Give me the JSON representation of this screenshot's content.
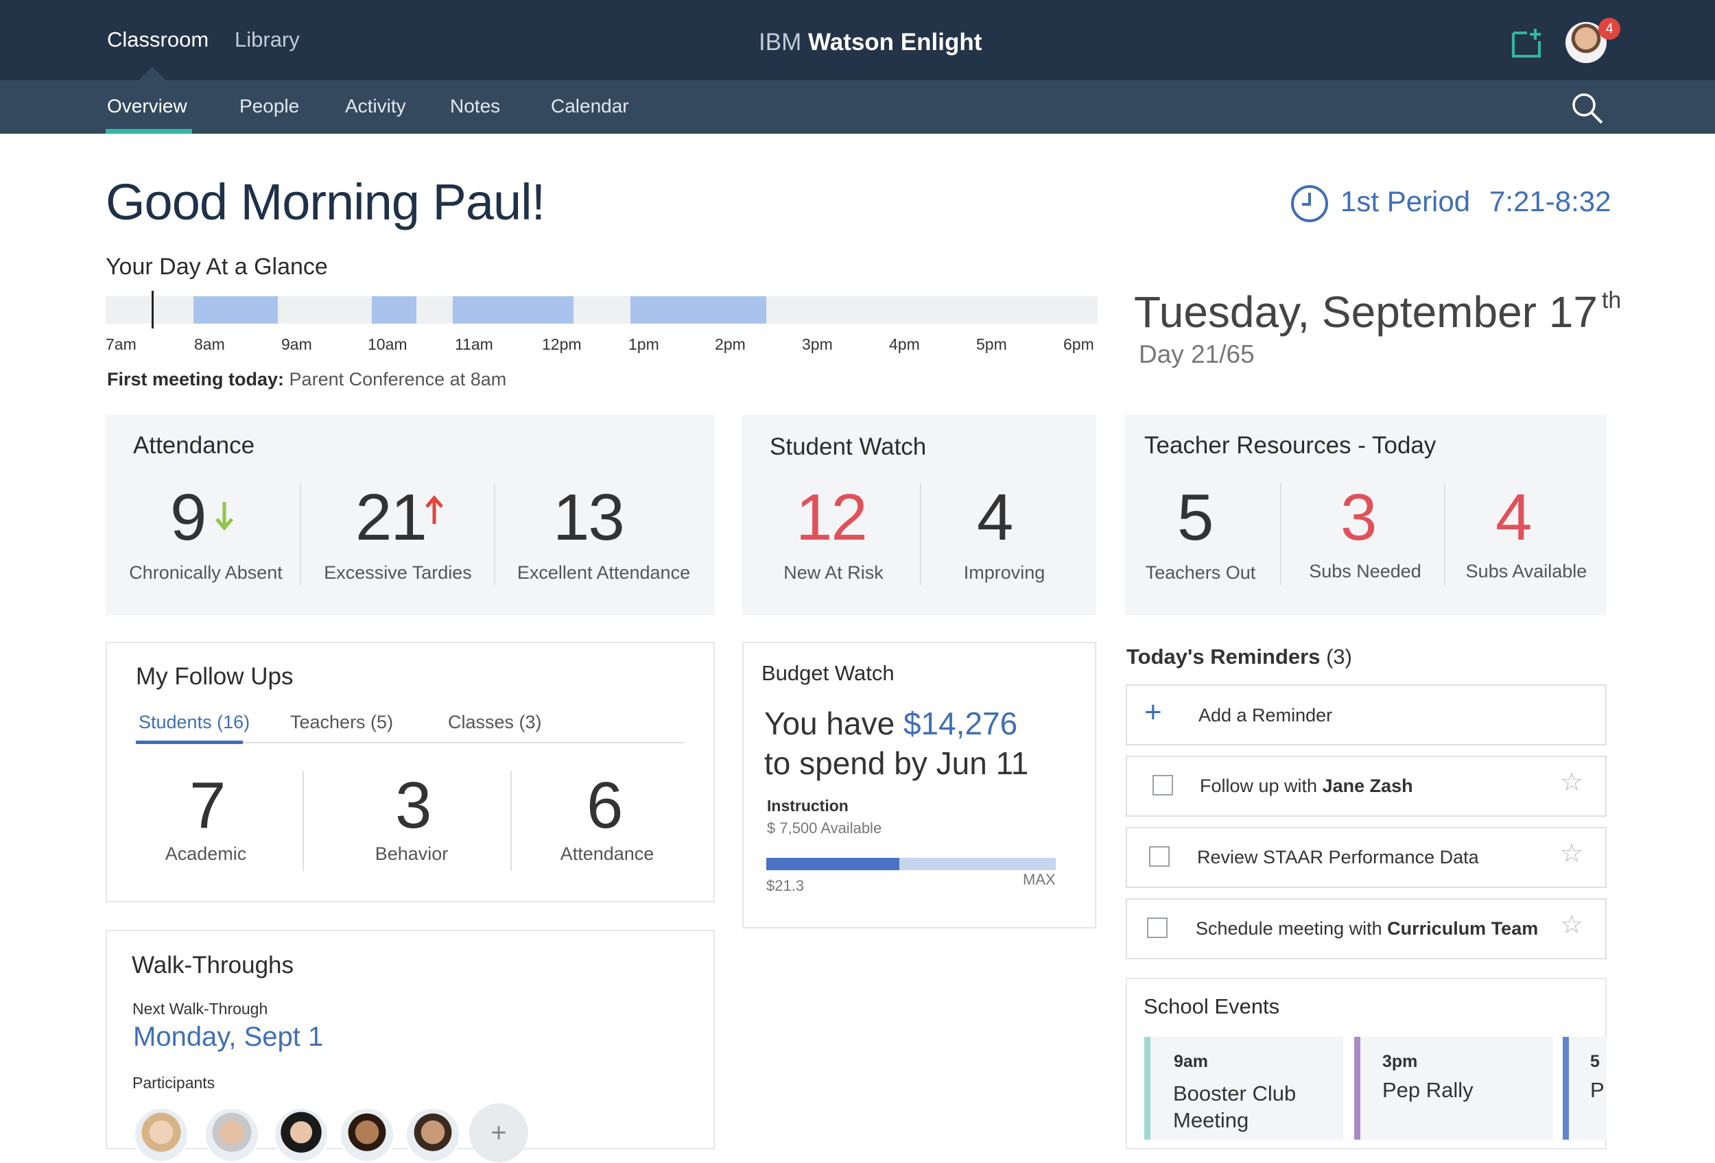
{
  "nav": {
    "primary": [
      "Classroom",
      "Library"
    ],
    "brand_prefix": "IBM",
    "brand_name": "Watson Enlight",
    "notifications": "4",
    "tabs": [
      "Overview",
      "People",
      "Activity",
      "Notes",
      "Calendar"
    ],
    "active_tab": "Overview"
  },
  "header": {
    "greeting": "Good Morning Paul!",
    "period_name": "1st Period",
    "period_time": "7:21-8:32"
  },
  "glance": {
    "title": "Your Day At a Glance",
    "ticks": [
      "7am",
      "8am",
      "9am",
      "10am",
      "11am",
      "12pm",
      "1pm",
      "2pm",
      "3pm",
      "4pm",
      "5pm",
      "6pm"
    ],
    "first_meeting_label": "First meeting today:",
    "first_meeting_value": "Parent Conference at 8am"
  },
  "date": {
    "text": "Tuesday, September 17",
    "suffix": "th",
    "day_count": "Day 21/65"
  },
  "attendance": {
    "title": "Attendance",
    "stats": [
      {
        "value": "9",
        "label": "Chronically Absent",
        "trend": "down"
      },
      {
        "value": "21",
        "label": "Excessive Tardies",
        "trend": "up"
      },
      {
        "value": "13",
        "label": "Excellent Attendance"
      }
    ]
  },
  "student_watch": {
    "title": "Student Watch",
    "stats": [
      {
        "value": "12",
        "label": "New At Risk"
      },
      {
        "value": "4",
        "label": "Improving"
      }
    ]
  },
  "teacher_resources": {
    "title": "Teacher Resources - Today",
    "stats": [
      {
        "value": "5",
        "label": "Teachers Out"
      },
      {
        "value": "3",
        "label": "Subs Needed"
      },
      {
        "value": "4",
        "label": "Subs Available"
      }
    ]
  },
  "follow_ups": {
    "title": "My Follow Ups",
    "tabs": [
      "Students (16)",
      "Teachers (5)",
      "Classes (3)"
    ],
    "stats": [
      {
        "value": "7",
        "label": "Academic"
      },
      {
        "value": "3",
        "label": "Behavior"
      },
      {
        "value": "6",
        "label": "Attendance"
      }
    ]
  },
  "budget": {
    "title": "Budget Watch",
    "line1_prefix": "You have",
    "amount": "$14,276",
    "line2": "to spend by Jun 11",
    "category": "Instruction",
    "available": "$ 7,500 Available",
    "bar_min_label": "$21.3",
    "bar_max_label": "MAX",
    "fill_fraction": 0.46
  },
  "reminders": {
    "title": "Today's Reminders",
    "count": "(3)",
    "add_label": "Add a Reminder",
    "items": [
      {
        "prefix": "Follow up with ",
        "bold": "Jane Zash"
      },
      {
        "prefix": "Review STAAR Performance Data",
        "bold": ""
      },
      {
        "prefix": "Schedule meeting with ",
        "bold": "Curriculum Team"
      }
    ]
  },
  "walk_throughs": {
    "title": "Walk-Throughs",
    "next_label": "Next Walk-Through",
    "next_date": "Monday, Sept 1",
    "participants_label": "Participants",
    "add_icon": "+"
  },
  "events": {
    "title": "School Events",
    "items": [
      {
        "time": "9am",
        "name": "Booster Club Meeting",
        "color": "#9fd8d3"
      },
      {
        "time": "3pm",
        "name": "Pep Rally",
        "color": "#a98bc8"
      },
      {
        "time": "5",
        "name": "P",
        "color": "#5f87cf"
      }
    ]
  },
  "colors": {
    "nav": "#233449",
    "subnav": "#34495e",
    "accent": "#33b6a6",
    "link": "#3f6fb5",
    "alert": "#e0515a"
  }
}
